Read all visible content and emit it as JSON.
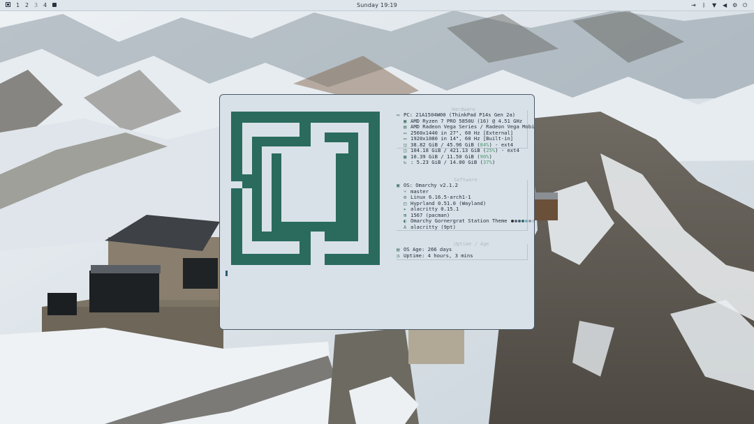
{
  "topbar": {
    "workspaces": [
      "1",
      "2",
      "3",
      "4"
    ],
    "clock": "Sunday 19:19",
    "tray_icons": [
      "logout-icon",
      "bluetooth-icon",
      "wifi-icon",
      "volume-icon",
      "cpu-icon",
      "power-icon"
    ]
  },
  "terminal": {
    "hardware": {
      "title": "Hardware",
      "pc": "PC: 21A1504W00 (ThinkPad P14s Gen 2a)",
      "cpu": "AMD Ryzen 7 PRO 5850U (16) @ 4.51 GHz",
      "gpu": "AMD Radeon Vega Series / Radeon Vega Mobi]",
      "display_ext": "2560x1440 in 27\", 60 Hz [External]",
      "display_int": "1920x1080 in 14\", 60 Hz [Built-in]",
      "disk1": {
        "prefix": "38.82 GiB / 45.96 GiB (",
        "pct": "84%",
        "suffix": ") - ext4"
      },
      "disk2": {
        "prefix": "104.18 GiB / 421.13 GiB (",
        "pct": "25%",
        "suffix": ") - ext4"
      },
      "mem": {
        "prefix": "10.39 GiB / 11.50 GiB (",
        "pct": "90%",
        "suffix": ")"
      },
      "swap": {
        "prefix": ": 5.23 GiB / 14.00 GiB (",
        "pct": "37%",
        "suffix": ")"
      }
    },
    "software": {
      "title": "Software",
      "os": "OS: Omarchy v2.1.2",
      "branch": "master",
      "kernel": "Linux 6.16.5-arch1-1",
      "wm": "Hyprland 0.51.0 (Wayland)",
      "terminal": "alacritty 0.15.1",
      "packages": "1567 (pacman)",
      "theme": "Omarchy Gornergrat Station Theme",
      "font": "alacritty (9pt)",
      "theme_colors": [
        "#2a2f36",
        "#5a6470",
        "#3f5d75",
        "#2c6b61",
        "#7aa7c0",
        "#8c96a0",
        "#b8c0c8"
      ]
    },
    "uptime": {
      "title": "Uptime / Age",
      "age": "OS Age: 266 days",
      "uptime": "Uptime: 4 hours, 3 mins"
    },
    "accent_color": "#2a6b5e",
    "background_color": "#d9e1e8"
  }
}
